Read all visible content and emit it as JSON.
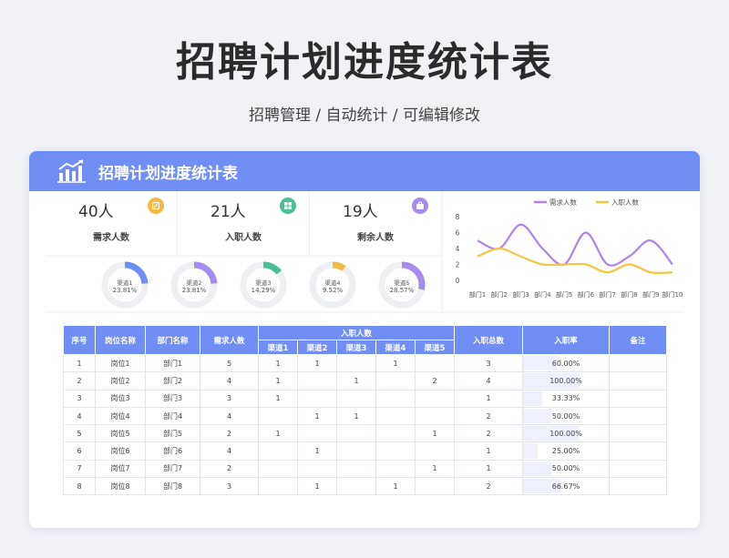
{
  "page": {
    "title": "招聘计划进度统计表",
    "subtitle": "招聘管理 / 自动统计 / 可编辑修改"
  },
  "card": {
    "title": "招聘计划进度统计表"
  },
  "stats": [
    {
      "value": "40人",
      "label": "需求人数",
      "color": "#f4b942",
      "icon": "edit-icon"
    },
    {
      "value": "21人",
      "label": "入职人数",
      "color": "#4cbf97",
      "icon": "grid-icon"
    },
    {
      "value": "19人",
      "label": "剩余人数",
      "color": "#a68cf0",
      "icon": "briefcase-icon"
    }
  ],
  "donuts": [
    {
      "label": "渠道1",
      "percent_text": "23.81%",
      "value": 23.81,
      "color": "#6f8ef6"
    },
    {
      "label": "渠道2",
      "percent_text": "23.81%",
      "value": 23.81,
      "color": "#a68cf0"
    },
    {
      "label": "渠道3",
      "percent_text": "14.29%",
      "value": 14.29,
      "color": "#4cbf97"
    },
    {
      "label": "渠道4",
      "percent_text": "9.52%",
      "value": 9.52,
      "color": "#f4b942"
    },
    {
      "label": "渠道5",
      "percent_text": "28.57%",
      "value": 28.57,
      "color": "#a68cf0"
    }
  ],
  "chart_data": {
    "type": "line",
    "categories": [
      "部门1",
      "部门2",
      "部门3",
      "部门4",
      "部门5",
      "部门6",
      "部门7",
      "部门8",
      "部门9",
      "部门10"
    ],
    "series": [
      {
        "name": "需求人数",
        "color": "#b083f0",
        "values": [
          5,
          4,
          7,
          4,
          2,
          6,
          2,
          3,
          5,
          2
        ]
      },
      {
        "name": "入职人数",
        "color": "#f4c542",
        "values": [
          3,
          4,
          3,
          2,
          2,
          2,
          1,
          2,
          1,
          1
        ]
      }
    ],
    "ylim": [
      0,
      8
    ],
    "yticks": [
      0,
      2,
      4,
      6,
      8
    ],
    "legend": "top-center",
    "grid": false
  },
  "table": {
    "headers": {
      "no": "序号",
      "post": "岗位名称",
      "dept": "部门名称",
      "demand": "需求人数",
      "hired_group": "入职人数",
      "channels": [
        "渠道1",
        "渠道2",
        "渠道3",
        "渠道4",
        "渠道5"
      ],
      "total": "入职总数",
      "rate": "入职率",
      "note": "备注"
    },
    "rows": [
      {
        "no": "1",
        "post": "岗位1",
        "dept": "部门1",
        "demand": "5",
        "ch": [
          "1",
          "1",
          "",
          "1",
          ""
        ],
        "total": "3",
        "rate": "60.00%",
        "rate_value": 0.6,
        "note": ""
      },
      {
        "no": "2",
        "post": "岗位2",
        "dept": "部门2",
        "demand": "4",
        "ch": [
          "1",
          "",
          "1",
          "",
          "2"
        ],
        "total": "4",
        "rate": "100.00%",
        "rate_value": 1.0,
        "note": ""
      },
      {
        "no": "3",
        "post": "岗位3",
        "dept": "部门3",
        "demand": "3",
        "ch": [
          "1",
          "",
          "",
          "",
          ""
        ],
        "total": "1",
        "rate": "33.33%",
        "rate_value": 0.3333,
        "note": ""
      },
      {
        "no": "4",
        "post": "岗位4",
        "dept": "部门4",
        "demand": "4",
        "ch": [
          "",
          "1",
          "1",
          "",
          ""
        ],
        "total": "2",
        "rate": "50.00%",
        "rate_value": 0.5,
        "note": ""
      },
      {
        "no": "5",
        "post": "岗位5",
        "dept": "部门5",
        "demand": "2",
        "ch": [
          "1",
          "",
          "",
          "",
          "1"
        ],
        "total": "2",
        "rate": "100.00%",
        "rate_value": 1.0,
        "note": ""
      },
      {
        "no": "6",
        "post": "岗位6",
        "dept": "部门6",
        "demand": "4",
        "ch": [
          "",
          "1",
          "",
          "",
          ""
        ],
        "total": "1",
        "rate": "25.00%",
        "rate_value": 0.25,
        "note": ""
      },
      {
        "no": "7",
        "post": "岗位7",
        "dept": "部门7",
        "demand": "2",
        "ch": [
          "",
          "",
          "",
          "",
          "1"
        ],
        "total": "1",
        "rate": "50.00%",
        "rate_value": 0.5,
        "note": ""
      },
      {
        "no": "8",
        "post": "岗位8",
        "dept": "部门8",
        "demand": "3",
        "ch": [
          "",
          "1",
          "",
          "1",
          ""
        ],
        "total": "2",
        "rate": "66.67%",
        "rate_value": 0.6667,
        "note": ""
      }
    ]
  }
}
